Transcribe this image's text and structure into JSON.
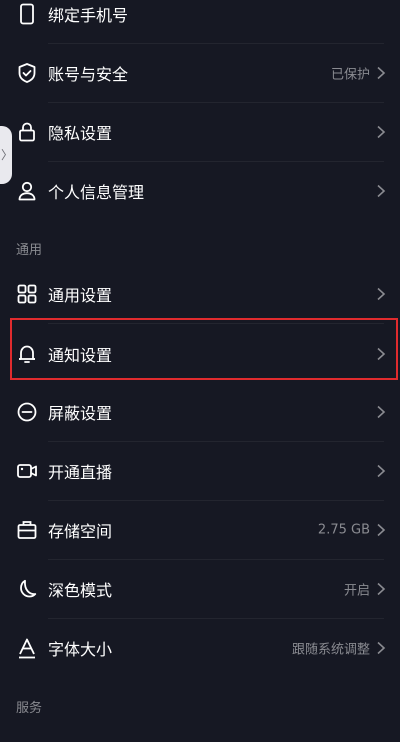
{
  "settings": {
    "account_rows": [
      {
        "label": "绑定手机号",
        "value": "",
        "icon": "phone-icon"
      },
      {
        "label": "账号与安全",
        "value": "已保护",
        "icon": "shield-check-icon"
      },
      {
        "label": "隐私设置",
        "value": "",
        "icon": "lock-icon"
      },
      {
        "label": "个人信息管理",
        "value": "",
        "icon": "user-icon"
      }
    ],
    "general_section": "通用",
    "general_rows": [
      {
        "label": "通用设置",
        "value": "",
        "icon": "grid-icon"
      },
      {
        "label": "通知设置",
        "value": "",
        "icon": "bell-icon"
      },
      {
        "label": "屏蔽设置",
        "value": "",
        "icon": "block-icon"
      },
      {
        "label": "开通直播",
        "value": "",
        "icon": "video-camera-icon"
      },
      {
        "label": "存储空间",
        "value": "2.75 GB",
        "icon": "storage-icon"
      },
      {
        "label": "深色模式",
        "value": "开启",
        "icon": "moon-icon"
      },
      {
        "label": "字体大小",
        "value": "跟随系统调整",
        "icon": "font-size-icon"
      }
    ],
    "service_section": "服务",
    "handle_glyph": "〉"
  },
  "colors": {
    "background": "#161823",
    "highlight": "#e02b2e",
    "secondary_text": "#8a8b91"
  }
}
